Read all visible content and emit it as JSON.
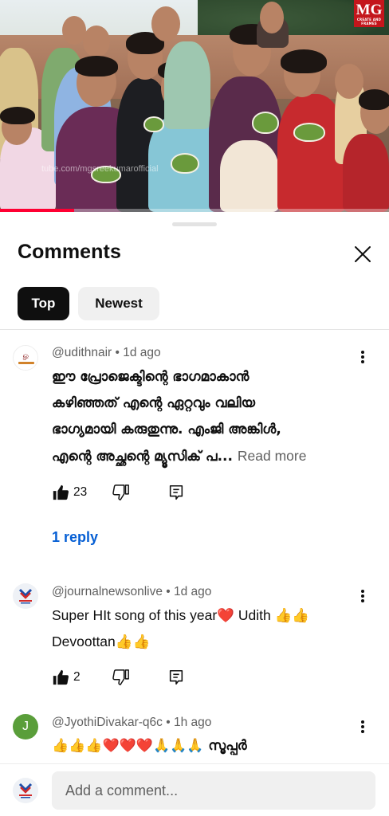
{
  "video": {
    "logo_text": "MG",
    "logo_subtext": "CREATE AND FRAMES",
    "watermark": "tube.com/mgsreekumarofficial",
    "progress": 0.19
  },
  "sheet": {
    "title": "Comments",
    "close_icon": "close-icon",
    "chips": [
      {
        "label": "Top",
        "selected": true
      },
      {
        "label": "Newest",
        "selected": false
      }
    ]
  },
  "comments": [
    {
      "author": "@udithnair",
      "age": "1d ago",
      "lines": [
        "ഈ പ്രോജെക്ടിന്റെ ഭാഗമാകാൻ",
        "കഴിഞ്ഞത് എന്റെ ഏറ്റവും വലിയ",
        "ഭാഗ്യമായി കരുതുന്നു. എംജി അങ്കിൾ,",
        "എന്റെ അച്ഛന്റെ മ്യൂസിക് പ..."
      ],
      "read_more": "Read more",
      "likes": "23",
      "replies": "1 reply"
    },
    {
      "author": "@journalnewsonlive",
      "age": "1d ago",
      "lines": [
        "Super HIt song of this year❤️ Udith 👍👍",
        "Devoottan👍👍"
      ],
      "likes": "2"
    },
    {
      "author": "@JyothiDivakar-q6c",
      "age": "1h ago",
      "avatar_letter": "J",
      "lines": [
        "👍👍👍❤️❤️❤️🙏🙏🙏 സൂപ്പർ"
      ]
    }
  ],
  "composer": {
    "placeholder": "Add a comment..."
  },
  "colors": {
    "accent_link": "#065fd4",
    "chip_selected_bg": "#0f0f0f",
    "progress_red": "#ff0033",
    "avatar_green": "#5a9e3a"
  }
}
